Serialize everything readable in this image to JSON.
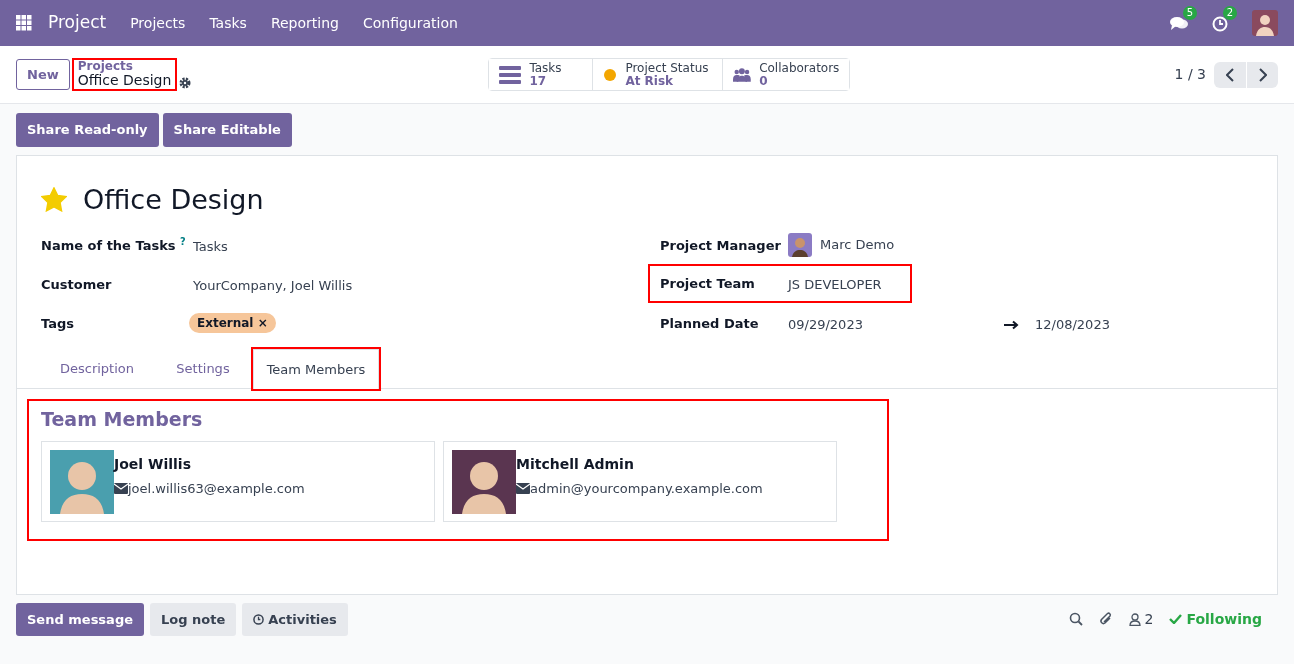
{
  "navbar": {
    "app": "Project",
    "menus": [
      "Projects",
      "Tasks",
      "Reporting",
      "Configuration"
    ],
    "messages_count": "5",
    "activities_count": "2"
  },
  "control_panel": {
    "new_button": "New",
    "breadcrumb": {
      "parent": "Projects",
      "current": "Office Design",
      "highlighted": true
    },
    "stat_buttons": [
      {
        "kind": "tasks",
        "label": "Tasks",
        "value": "17"
      },
      {
        "kind": "status",
        "label": "Project Status",
        "value": "At Risk",
        "color": "#f3a600"
      },
      {
        "kind": "collaborators",
        "label": "Collaborators",
        "value": "0"
      }
    ],
    "pager": "1 / 3"
  },
  "actions": [
    "Share Read-only",
    "Share Editable"
  ],
  "form": {
    "title": "Office Design",
    "favorite": true,
    "left_fields": [
      {
        "kind": "text",
        "label": "Name of the Tasks",
        "help": "?",
        "value": "Tasks",
        "highlighted": false
      },
      {
        "kind": "text",
        "label": "Customer",
        "value": "YourCompany, Joel Willis",
        "highlighted": false
      },
      {
        "kind": "tags",
        "label": "Tags",
        "tags": [
          {
            "label": "External",
            "remove": "×",
            "color": "#f6c69a"
          }
        ],
        "highlighted": false
      }
    ],
    "right_fields": [
      {
        "kind": "user",
        "label": "Project Manager",
        "value": "Marc Demo",
        "highlighted": false
      },
      {
        "kind": "text",
        "label": "Project Team",
        "value": "JS DEVELOPER",
        "highlighted": true
      },
      {
        "kind": "daterange",
        "label": "Planned Date",
        "value": "09/29/2023",
        "end": "12/08/2023",
        "highlighted": false
      }
    ],
    "tabs": [
      {
        "label": "Description",
        "selected": false,
        "highlighted": false
      },
      {
        "label": "Settings",
        "selected": false,
        "highlighted": false
      },
      {
        "label": "Team Members",
        "selected": true,
        "highlighted": true
      }
    ],
    "team_members": {
      "title": "Team Members",
      "highlighted": true,
      "members": [
        {
          "name": "Joel Willis",
          "email": "joel.willis63@example.com",
          "color": "#4a9fae"
        },
        {
          "name": "Mitchell Admin",
          "email": "admin@yourcompany.example.com",
          "color": "#5a3550"
        }
      ]
    }
  },
  "chatter": {
    "buttons": [
      "Send message",
      "Log note",
      "Activities"
    ],
    "followers": "2",
    "following": "Following"
  }
}
